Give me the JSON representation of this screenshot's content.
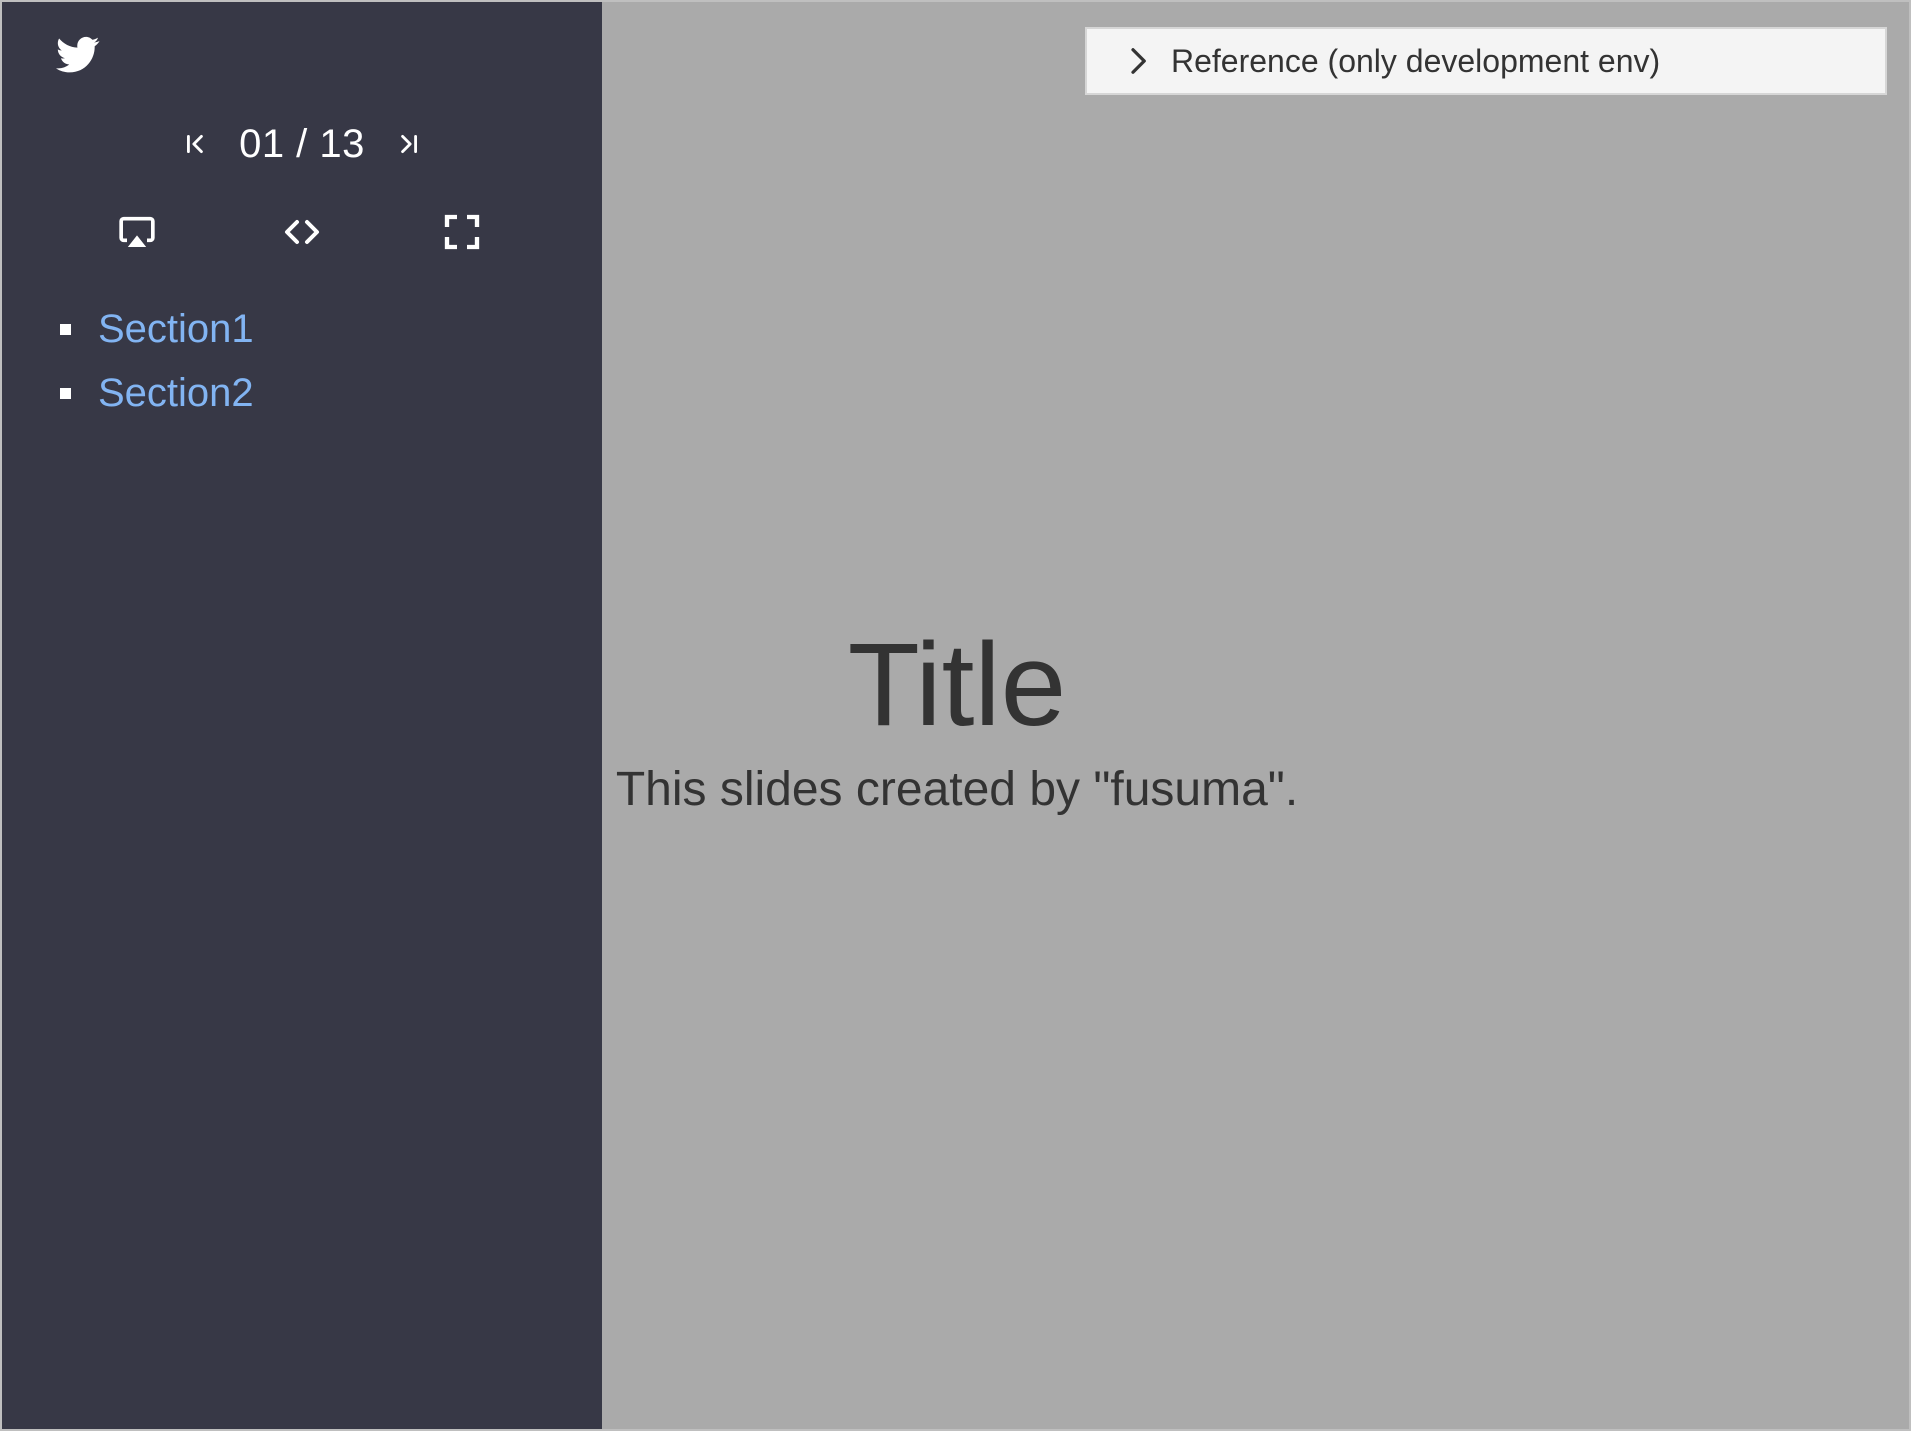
{
  "sidebar": {
    "share_icon": "twitter-icon",
    "pager": {
      "first_icon": "first-page-icon",
      "indicator": "01 / 13",
      "last_icon": "last-page-icon"
    },
    "tools": [
      {
        "name": "presenter-mode",
        "icon": "airplay-icon"
      },
      {
        "name": "code",
        "icon": "code-icon"
      },
      {
        "name": "fullscreen",
        "icon": "fullscreen-icon"
      }
    ],
    "toc": [
      {
        "label": "Section1"
      },
      {
        "label": "Section2"
      }
    ]
  },
  "reference": {
    "icon": "chevron-right-icon",
    "label": "Reference (only development env)"
  },
  "slide": {
    "title": "Title",
    "subtitle": "This slides created by \"fusuma\"."
  },
  "colors": {
    "sidebar_bg": "#373846",
    "slide_bg": "#aaaaaa",
    "link": "#82b4f2",
    "text": "#333333"
  }
}
